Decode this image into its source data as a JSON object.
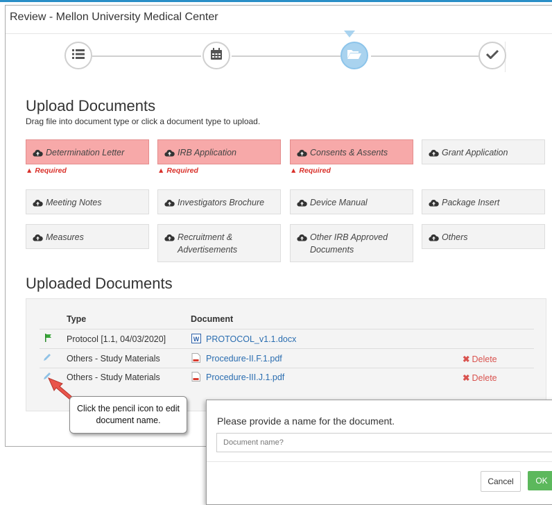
{
  "window": {
    "title": "Review - Mellon University Medical Center"
  },
  "colors": {
    "accent": "#2a8fc7",
    "required_bg": "#f7a9a9",
    "required_text": "#d9302a",
    "link": "#2a6db0",
    "delete": "#d9534f",
    "ok": "#5cb85c"
  },
  "stepper": {
    "steps": [
      {
        "icon": "list-icon",
        "state": "done"
      },
      {
        "icon": "calendar-icon",
        "state": "done"
      },
      {
        "icon": "folder-open-icon",
        "state": "active"
      },
      {
        "icon": "checkmark-icon",
        "state": "pending"
      }
    ]
  },
  "upload": {
    "heading": "Upload Documents",
    "hint": "Drag file into document type or click a document type to upload.",
    "required_label": "Required",
    "types": [
      {
        "label": "Determination Letter",
        "required": true
      },
      {
        "label": "IRB Application",
        "required": true
      },
      {
        "label": "Consents & Assents",
        "required": true
      },
      {
        "label": "Grant Application",
        "required": false
      },
      {
        "label": "Meeting Notes",
        "required": false
      },
      {
        "label": "Investigators Brochure",
        "required": false
      },
      {
        "label": "Device Manual",
        "required": false
      },
      {
        "label": "Package Insert",
        "required": false
      },
      {
        "label": "Measures",
        "required": false
      },
      {
        "label": "Recruitment & Advertisements",
        "required": false
      },
      {
        "label": "Other IRB Approved Documents",
        "required": false
      },
      {
        "label": "Others",
        "required": false
      }
    ]
  },
  "uploaded": {
    "heading": "Uploaded Documents",
    "columns": {
      "type": "Type",
      "document": "Document"
    },
    "delete_label": "Delete",
    "rows": [
      {
        "icon": "flag-icon",
        "type": "Protocol [1.1, 04/03/2020]",
        "file_icon": "word-doc-icon",
        "document": "PROTOCOL_v1.1.docx",
        "deletable": false
      },
      {
        "icon": "pencil-icon",
        "type": "Others - Study Materials",
        "file_icon": "pdf-icon",
        "document": "Procedure-II.F.1.pdf",
        "deletable": true
      },
      {
        "icon": "pencil-icon",
        "type": "Others - Study Materials",
        "file_icon": "pdf-icon",
        "document": "Procedure-III.J.1.pdf",
        "deletable": true
      }
    ]
  },
  "callout": {
    "text": "Click the pencil icon to edit document name."
  },
  "dialog": {
    "title": "Please provide a name for the document.",
    "input_placeholder": "Document name?",
    "input_value": "",
    "cancel_label": "Cancel",
    "ok_label": "OK"
  }
}
